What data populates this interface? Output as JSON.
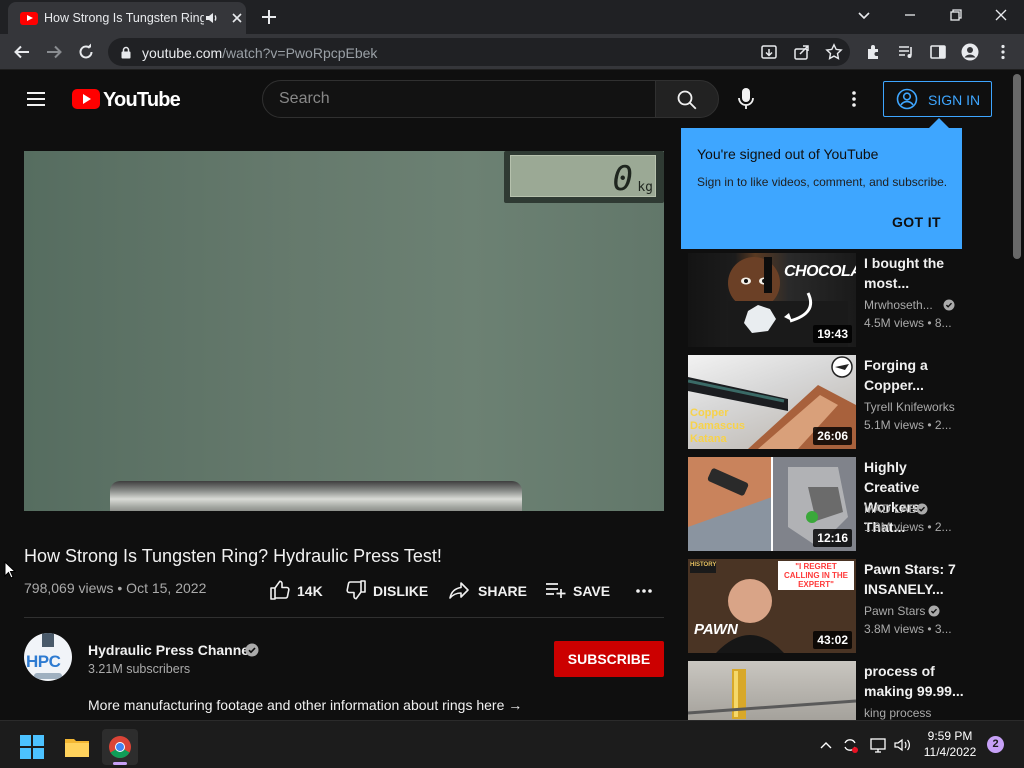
{
  "browser": {
    "tab_title": "How Strong Is Tungsten Ring? Hydraulic Press Test! - YouTube",
    "url_host": "youtube.com",
    "url_path": "/watch?v=PwoRpcpEbek"
  },
  "header": {
    "logo_text": "YouTube",
    "search_placeholder": "Search",
    "sign_in_label": "SIGN IN"
  },
  "popup": {
    "heading": "You're signed out of YouTube",
    "body": "Sign in to like videos, comment, and subscribe.",
    "button": "GOT IT"
  },
  "player": {
    "scale_reading": "0",
    "scale_unit": "kg"
  },
  "video": {
    "title": "How Strong Is Tungsten Ring? Hydraulic Press Test!",
    "meta": "798,069 views • Oct 15, 2022",
    "likes": "14K",
    "dislike_label": "DISLIKE",
    "share_label": "SHARE",
    "save_label": "SAVE"
  },
  "channel": {
    "avatar_text": "HPC",
    "name": "Hydraulic Press Channel",
    "subscribers": "3.21M subscribers",
    "subscribe_label": "SUBSCRIBE",
    "description": "More manufacturing footage and other information about rings here →"
  },
  "recommendations": [
    {
      "title": "I bought the most...",
      "channel": "Mrwhoseth...",
      "verified": true,
      "views": "4.5M views • 8...",
      "duration": "19:43",
      "overlay": "CHOCOLATE"
    },
    {
      "title": "Forging a Copper...",
      "channel": "Tyrell Knifeworks",
      "verified": false,
      "views": "5.1M views • 2...",
      "duration": "26:06",
      "overlay": "Copper Damascus Katana"
    },
    {
      "title": "Highly Creative Workers That...",
      "channel": "MAD LAB",
      "verified": true,
      "views": "1.9M views • 2...",
      "duration": "12:16",
      "overlay": ""
    },
    {
      "title": "Pawn Stars: 7 INSANELY...",
      "channel": "Pawn Stars",
      "verified": true,
      "views": "3.8M views • 3...",
      "duration": "43:02",
      "overlay": "\"I REGRET CALLING IN THE EXPERT\""
    },
    {
      "title": "process of making 99.99...",
      "channel": "king process",
      "verified": false,
      "views": "",
      "duration": "",
      "overlay": ""
    }
  ],
  "taskbar": {
    "time": "9:59 PM",
    "date": "11/4/2022",
    "notifications": "2"
  }
}
